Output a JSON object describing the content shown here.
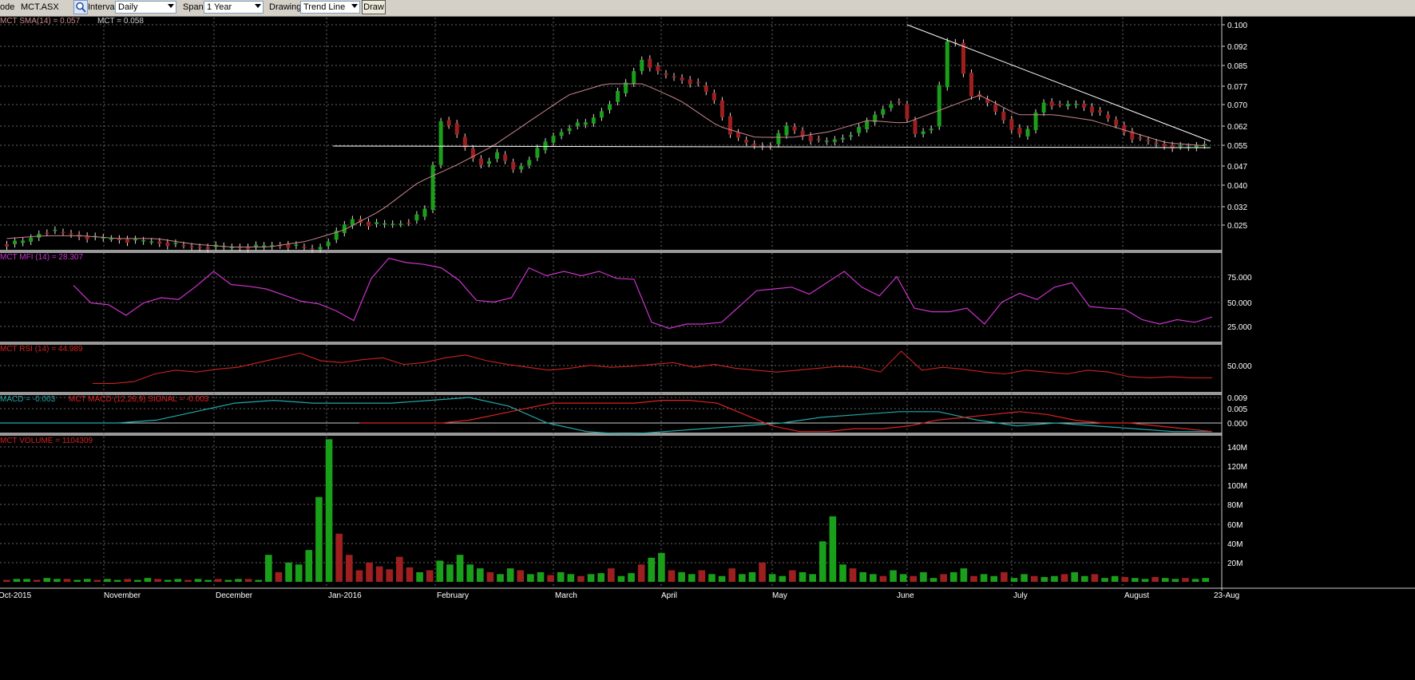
{
  "toolbar": {
    "code_label": "ode",
    "code_value": "MCT.ASX",
    "interval_label": "Interval",
    "interval_value": "Daily",
    "span_label": "Span",
    "span_value": "1 Year",
    "drawing_label": "Drawing",
    "drawing_value": "Trend Line",
    "draw_button": "Draw"
  },
  "colors": {
    "up": "#1a9f1a",
    "down": "#9e1f1f",
    "sma": "#c8868c",
    "mfi": "#cc33cc",
    "rsi": "#cc2222",
    "macd": "#22aaaa",
    "signal": "#dd2222",
    "trendline": "#ffffff",
    "grid": "#666666"
  },
  "panels": {
    "price_legend_1": "MCT SMA(14) = 0.057",
    "price_legend_2": "MCT = 0.058",
    "mfi_legend": "MCT MFI (14) = 28.307",
    "rsi_legend": "MCT RSI (14) = 44.989",
    "macd_legend_1": "MACD = -0.003",
    "macd_legend_2": "MCT MACD (12,26,9) SIGNAL = -0.003",
    "volume_legend": "MCT VOLUME = 1104309"
  },
  "axes": {
    "price_ticks": [
      "0.100",
      "0.092",
      "0.085",
      "0.077",
      "0.070",
      "0.062",
      "0.055",
      "0.047",
      "0.040",
      "0.032",
      "0.025"
    ],
    "mfi_ticks": [
      "75.000",
      "50.000",
      "25.000"
    ],
    "rsi_ticks": [
      "50.000"
    ],
    "macd_ticks": [
      "0.009",
      "0.005",
      "0.000"
    ],
    "volume_ticks": [
      "140M",
      "120M",
      "100M",
      "80M",
      "60M",
      "40M",
      "20M"
    ],
    "month_labels": [
      "Oct-2015",
      "November",
      "December",
      "Jan-2016",
      "February",
      "March",
      "April",
      "May",
      "June",
      "July",
      "August",
      "23-Aug"
    ]
  },
  "chart_data": [
    {
      "type": "candlestick",
      "series": [
        {
          "name": "MCT",
          "description": "daily price, estimated",
          "values_close": [
            0.022,
            0.023,
            0.027,
            0.026,
            0.025,
            0.024,
            0.024,
            0.023,
            0.023,
            0.022,
            0.021,
            0.021,
            0.021,
            0.021,
            0.021,
            0.022,
            0.021,
            0.02,
            0.025,
            0.031,
            0.029,
            0.029,
            0.03,
            0.033,
            0.069,
            0.058,
            0.05,
            0.054,
            0.048,
            0.054,
            0.06,
            0.064,
            0.065,
            0.071,
            0.078,
            0.088,
            0.082,
            0.081,
            0.079,
            0.073,
            0.06,
            0.057,
            0.057,
            0.064,
            0.06,
            0.058,
            0.06,
            0.063,
            0.069,
            0.074,
            0.061,
            0.064,
            0.1,
            0.076,
            0.072,
            0.066,
            0.059,
            0.073,
            0.071,
            0.072,
            0.069,
            0.065,
            0.06,
            0.058,
            0.057,
            0.056,
            0.058
          ]
        },
        {
          "name": "SMA(14)",
          "values": [
            0.024,
            0.025,
            0.025,
            0.024,
            0.024,
            0.022,
            0.021,
            0.021,
            0.023,
            0.027,
            0.034,
            0.044,
            0.05,
            0.057,
            0.066,
            0.075,
            0.079,
            0.079,
            0.073,
            0.064,
            0.06,
            0.06,
            0.062,
            0.066,
            0.065,
            0.07,
            0.075,
            0.068,
            0.068,
            0.066,
            0.062,
            0.058,
            0.057
          ]
        }
      ],
      "x": [
        "Oct-2015",
        "November",
        "December",
        "Jan-2016",
        "February",
        "March",
        "April",
        "May",
        "June",
        "July",
        "August",
        "23-Aug"
      ],
      "ylim": [
        0.02,
        0.1
      ],
      "ticks": [
        "0.100",
        "0.092",
        "0.085",
        "0.077",
        "0.070",
        "0.062",
        "0.055",
        "0.047",
        "0.040",
        "0.032",
        "0.025"
      ]
    },
    {
      "type": "line",
      "series": [
        {
          "name": "MFI (14)",
          "values": [
            64,
            44,
            42,
            30,
            44,
            50,
            48,
            63,
            80,
            65,
            63,
            60,
            53,
            46,
            43,
            35,
            24,
            72,
            95,
            90,
            88,
            84,
            70,
            47,
            45,
            50,
            84,
            75,
            80,
            75,
            80,
            72,
            71,
            22,
            15,
            20,
            20,
            22,
            40,
            58,
            60,
            62,
            54,
            67,
            80,
            62,
            52,
            74,
            38,
            34,
            34,
            38,
            20,
            45,
            55,
            48,
            62,
            67,
            40,
            38,
            37,
            25,
            20,
            25,
            22,
            28
          ]
        }
      ],
      "ylim": [
        0,
        100
      ],
      "ticks": [
        "75.000",
        "50.000",
        "25.000"
      ]
    },
    {
      "type": "line",
      "series": [
        {
          "name": "RSI (14)",
          "values": [
            38,
            38,
            40,
            48,
            52,
            50,
            53,
            55,
            60,
            65,
            70,
            62,
            60,
            63,
            65,
            58,
            60,
            65,
            68,
            62,
            58,
            55,
            52,
            54,
            57,
            55,
            56,
            58,
            60,
            55,
            58,
            54,
            52,
            50,
            52,
            54,
            56,
            55,
            50,
            72,
            52,
            55,
            53,
            50,
            48,
            52,
            50,
            48,
            52,
            50,
            45,
            44,
            45,
            44,
            44
          ]
        }
      ],
      "ylim": [
        0,
        100
      ],
      "ticks": [
        "50.000"
      ]
    },
    {
      "type": "line",
      "series": [
        {
          "name": "MACD",
          "values": [
            0.0,
            0.0,
            0.0,
            0.0,
            0.001,
            0.004,
            0.007,
            0.008,
            0.007,
            0.007,
            0.007,
            0.008,
            0.009,
            0.006,
            0.0,
            -0.003,
            -0.004,
            -0.003,
            -0.002,
            -0.001,
            0.0,
            0.002,
            0.003,
            0.004,
            0.004,
            0.001,
            -0.001,
            0.0,
            -0.001,
            -0.002,
            -0.003,
            -0.003
          ]
        },
        {
          "name": "SIGNAL",
          "values": [
            0.0,
            0.0,
            0.0,
            0.0,
            0.001,
            0.003,
            0.005,
            0.007,
            0.007,
            0.007,
            0.007,
            0.008,
            0.008,
            0.007,
            0.003,
            -0.001,
            -0.003,
            -0.003,
            -0.002,
            -0.002,
            -0.001,
            0.001,
            0.002,
            0.003,
            0.004,
            0.003,
            0.001,
            0.0,
            0.0,
            -0.001,
            -0.002,
            -0.003
          ]
        }
      ],
      "ylim": [
        -0.004,
        0.011
      ],
      "ticks": [
        "0.009",
        "0.005",
        "0.000"
      ]
    },
    {
      "type": "bar",
      "series": [
        {
          "name": "VOLUME",
          "values_millions": [
            2,
            3,
            3,
            2,
            4,
            3,
            3,
            2,
            3,
            2,
            3,
            2,
            3,
            2,
            4,
            3,
            2,
            3,
            2,
            3,
            2,
            3,
            2,
            3,
            3,
            2,
            28,
            10,
            20,
            18,
            33,
            88,
            148,
            50,
            28,
            12,
            20,
            16,
            13,
            26,
            15,
            10,
            12,
            22,
            18,
            28,
            18,
            14,
            10,
            8,
            14,
            12,
            8,
            10,
            7,
            10,
            8,
            6,
            8,
            9,
            14,
            6,
            9,
            18,
            25,
            30,
            12,
            10,
            8,
            12,
            8,
            6,
            14,
            8,
            10,
            20,
            8,
            6,
            12,
            10,
            8,
            42,
            68,
            18,
            14,
            10,
            8,
            6,
            12,
            8,
            6,
            10,
            4,
            8,
            10,
            14,
            6,
            8,
            6,
            10,
            4,
            8,
            6,
            5,
            6,
            8,
            10,
            6,
            8,
            4,
            6,
            5,
            4,
            3,
            5,
            4,
            3,
            4,
            3,
            4
          ]
        }
      ],
      "ylim": [
        0,
        150
      ],
      "ticks": [
        "140M",
        "120M",
        "100M",
        "80M",
        "60M",
        "40M",
        "20M"
      ]
    }
  ]
}
